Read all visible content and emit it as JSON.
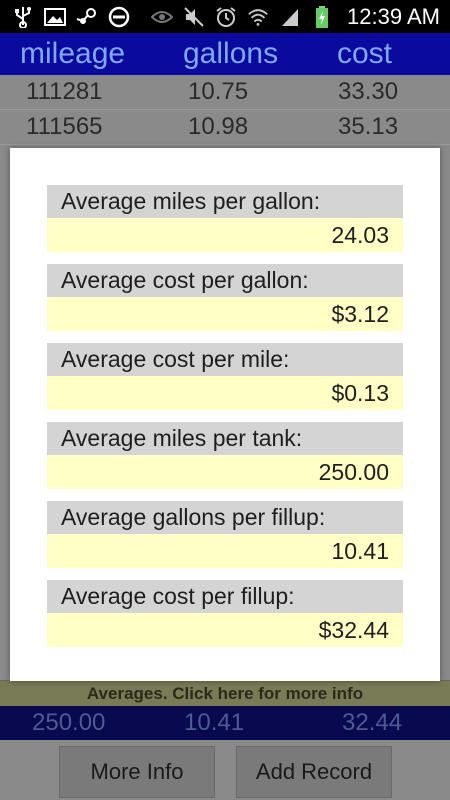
{
  "status_bar": {
    "time": "12:39 AM",
    "left_icons": [
      "usb-icon",
      "image-icon",
      "steam-icon",
      "block-icon"
    ],
    "right_icons": [
      "eye-icon",
      "mute-icon",
      "alarm-icon",
      "wifi-icon",
      "signal-icon",
      "battery-charging-icon"
    ]
  },
  "header": {
    "col1": "mileage",
    "col2": "gallons",
    "col3": "cost"
  },
  "rows": [
    {
      "mileage": "111281",
      "gallons": "10.75",
      "cost": "33.30"
    },
    {
      "mileage": "111565",
      "gallons": "10.98",
      "cost": "35.13"
    }
  ],
  "dialog": {
    "stats": [
      {
        "label": "Average miles per gallon:",
        "value": "24.03"
      },
      {
        "label": "Average cost per gallon:",
        "value": "$3.12"
      },
      {
        "label": "Average cost per mile:",
        "value": "$0.13"
      },
      {
        "label": "Average miles per tank:",
        "value": "250.00"
      },
      {
        "label": "Average gallons per fillup:",
        "value": "10.41"
      },
      {
        "label": "Average cost per fillup:",
        "value": "$32.44"
      }
    ]
  },
  "averages_bar": {
    "text": "Averages. Click here for more info"
  },
  "totals": {
    "mileage": "250.00",
    "gallons": "10.41",
    "cost": "32.44"
  },
  "buttons": {
    "more_info": "More Info",
    "add_record": "Add Record"
  },
  "colors": {
    "header_bg": "#0a0a9e",
    "header_text": "#7ea9ff",
    "value_bg": "#ffffc6",
    "label_bg": "#d4d4d4"
  }
}
